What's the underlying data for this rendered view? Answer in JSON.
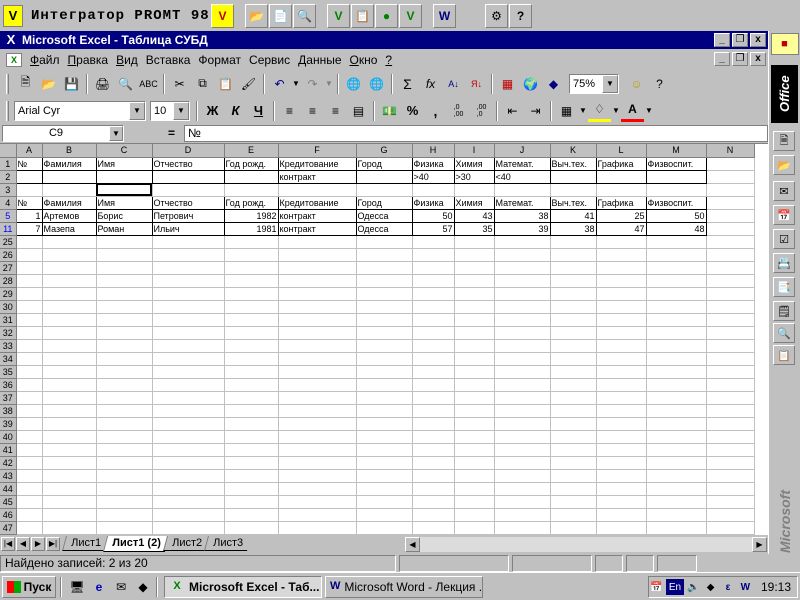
{
  "promt": {
    "title": "Интегратор PROMT 98",
    "buttons": [
      "promt-v-icon",
      "open-folder-icon",
      "translate-doc-icon",
      "search-doc-icon",
      "promt-v2-icon",
      "doc-settings-icon",
      "globe-icon",
      "promt-v3-icon",
      "word-translate-icon",
      "gear-icon",
      "help-icon"
    ]
  },
  "window": {
    "title": "Microsoft Excel - Таблица СУБД"
  },
  "menu": {
    "items": [
      {
        "u": "Ф",
        "rest": "айл"
      },
      {
        "u": "П",
        "rest": "равка"
      },
      {
        "u": "В",
        "rest": "ид"
      },
      {
        "u": "",
        "rest": "Вставка"
      },
      {
        "u": "",
        "rest": "Формат"
      },
      {
        "u": "",
        "rest": "Сервис"
      },
      {
        "u": "Д",
        "rest": "анные"
      },
      {
        "u": "О",
        "rest": "кно"
      },
      {
        "u": "?",
        "rest": ""
      }
    ]
  },
  "toolbar": {
    "zoom": "75%",
    "font_name": "Arial Cyr",
    "font_size": "10",
    "bold": "Ж",
    "italic": "К",
    "underline": "Ч",
    "sum": "Σ",
    "fx": "fx",
    "percent": "%",
    "comma": ",",
    "inc_decimal": ",0\n,00",
    "dec_decimal": ",00\n,0"
  },
  "formula": {
    "name_box": "C9",
    "eq": "=",
    "content": "№"
  },
  "grid": {
    "columns": [
      "A",
      "B",
      "C",
      "D",
      "E",
      "F",
      "G",
      "H",
      "I",
      "J",
      "K",
      "L",
      "M",
      "N"
    ],
    "rows": [
      {
        "n": "1",
        "cells": [
          "№",
          "Фамилия",
          "Имя",
          "Отчество",
          "Год рожд.",
          "Кредитование",
          "Город",
          "Физика",
          "Химия",
          "Математ.",
          "Выч.тех.",
          "Графика",
          "Физвоспит.",
          ""
        ]
      },
      {
        "n": "2",
        "cells": [
          "",
          "",
          "",
          "",
          "",
          "контракт",
          "",
          ">40",
          ">30",
          "<40",
          "",
          "",
          "",
          ""
        ]
      },
      {
        "n": "3",
        "cells": [
          "",
          "",
          "",
          "",
          "",
          "",
          "",
          "",
          "",
          "",
          "",
          "",
          "",
          ""
        ]
      },
      {
        "n": "4",
        "cells": [
          "№",
          "Фамилия",
          "Имя",
          "Отчество",
          "Год рожд.",
          "Кредитование",
          "Город",
          "Физика",
          "Химия",
          "Математ.",
          "Выч.тех.",
          "Графика",
          "Физвоспит.",
          ""
        ]
      },
      {
        "n": "5",
        "cells": [
          "1",
          "Артемов",
          "Борис",
          "Петрович",
          "1982",
          "контракт",
          "Одесса",
          "50",
          "43",
          "38",
          "41",
          "25",
          "50",
          ""
        ]
      },
      {
        "n": "11",
        "cells": [
          "7",
          "Мазепа",
          "Роман",
          "Ильич",
          "1981",
          "контракт",
          "Одесса",
          "57",
          "35",
          "39",
          "38",
          "47",
          "48",
          ""
        ]
      },
      {
        "n": "25",
        "cells": []
      },
      {
        "n": "26",
        "cells": []
      },
      {
        "n": "27",
        "cells": []
      },
      {
        "n": "28",
        "cells": []
      },
      {
        "n": "29",
        "cells": []
      },
      {
        "n": "30",
        "cells": []
      },
      {
        "n": "31",
        "cells": []
      },
      {
        "n": "32",
        "cells": []
      },
      {
        "n": "33",
        "cells": []
      },
      {
        "n": "34",
        "cells": []
      },
      {
        "n": "35",
        "cells": []
      },
      {
        "n": "36",
        "cells": []
      },
      {
        "n": "37",
        "cells": []
      },
      {
        "n": "38",
        "cells": []
      },
      {
        "n": "39",
        "cells": []
      },
      {
        "n": "40",
        "cells": []
      },
      {
        "n": "41",
        "cells": []
      },
      {
        "n": "42",
        "cells": []
      },
      {
        "n": "43",
        "cells": []
      },
      {
        "n": "44",
        "cells": []
      },
      {
        "n": "45",
        "cells": []
      },
      {
        "n": "46",
        "cells": []
      },
      {
        "n": "47",
        "cells": []
      }
    ],
    "filtered_row_color": "#0000ff"
  },
  "sheets": {
    "tabs": [
      "Лист1",
      "Лист1 (2)",
      "Лист2",
      "Лист3"
    ],
    "active": 1
  },
  "status": {
    "text": "Найдено записей: 2 из 20"
  },
  "office_bar": {
    "label": "Office",
    "brand": "Microsoft"
  },
  "taskbar": {
    "start": "Пуск",
    "tasks": [
      {
        "icon": "X",
        "label": "Microsoft Excel - Таб...",
        "active": true
      },
      {
        "icon": "W",
        "label": "Microsoft Word - Лекция ...",
        "active": false
      }
    ],
    "lang": "En",
    "clock": "19:13"
  }
}
